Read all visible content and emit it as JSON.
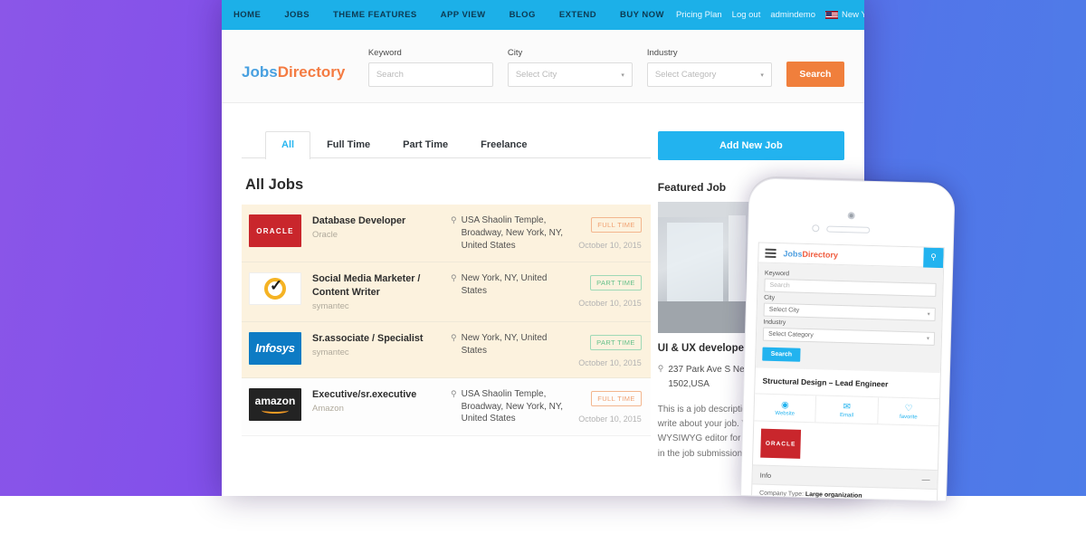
{
  "topnav": {
    "items": [
      "HOME",
      "JOBS",
      "THEME FEATURES",
      "APP VIEW",
      "BLOG",
      "EXTEND",
      "BUY NOW"
    ],
    "pricing_plan": "Pricing Plan",
    "logout": "Log out",
    "username": "admindemo",
    "location": "New York",
    "caret": "⌄"
  },
  "brand": {
    "part1": "Jobs",
    "part2": "Directory"
  },
  "search": {
    "keyword_label": "Keyword",
    "keyword_placeholder": "Search",
    "city_label": "City",
    "city_value": "Select City",
    "industry_label": "Industry",
    "industry_value": "Select Category",
    "button": "Search",
    "caret": "▾"
  },
  "tabs": [
    {
      "label": "All",
      "active": true
    },
    {
      "label": "Full Time",
      "active": false
    },
    {
      "label": "Part Time",
      "active": false
    },
    {
      "label": "Freelance",
      "active": false
    }
  ],
  "section_title": "All Jobs",
  "jobs": [
    {
      "logo": "ORACLE",
      "title": "Database Developer",
      "company": "Oracle",
      "location": "USA Shaolin Temple, Broadway, New York, NY, United States",
      "badge": "FULL TIME",
      "date": "October 10, 2015"
    },
    {
      "logo": "symantec-check",
      "title": "Social Media Marketer / Content Writer",
      "company": "symantec",
      "location": "New York, NY, United States",
      "badge": "PART TIME",
      "date": "October 10, 2015"
    },
    {
      "logo": "Infosys",
      "title": "Sr.associate / Specialist",
      "company": "symantec",
      "location": "New York, NY, United States",
      "badge": "PART TIME",
      "date": "October 10, 2015"
    },
    {
      "logo": "amazon",
      "title": "Executive/sr.executive",
      "company": "Amazon",
      "location": "USA Shaolin Temple, Broadway, New York, NY, United States",
      "badge": "FULL TIME",
      "date": "October 10, 2015"
    }
  ],
  "sidebar": {
    "add_job_button": "Add New Job",
    "featured_heading": "Featured Job",
    "featured_title": "UI & UX developer",
    "featured_location": "237 Park Ave S New York, NY 10003-1502,USA",
    "featured_desc": "This is a job description page where you can write about your job. We have added a WYSIWYG editor for entering this information in the job submission page so you can..."
  },
  "phone": {
    "brand_part1": "Jobs",
    "brand_part2": "Directory",
    "pin_icon": "pin-icon",
    "keyword_label": "Keyword",
    "keyword_placeholder": "Search",
    "city_label": "City",
    "city_value": "Select City",
    "industry_label": "Industry",
    "industry_value": "Select Category",
    "search_button": "Search",
    "job_title": "Structural Design – Lead Engineer",
    "actions": [
      {
        "icon": "globe-icon",
        "glyph": "◉",
        "label": "Website"
      },
      {
        "icon": "envelope-icon",
        "glyph": "✉",
        "label": "Email"
      },
      {
        "icon": "heart-icon",
        "glyph": "♡",
        "label": "favorite"
      }
    ],
    "logo": "ORACLE",
    "info_label": "Info",
    "info_collapse": "—",
    "company_type_label": "Company Type:",
    "company_type_value": "Large organization",
    "caret": "▾"
  },
  "colors": {
    "nav_blue": "#1cb0e8",
    "accent_orange": "#f07f3c",
    "brand_blue": "#48a0e0",
    "highlight_row": "#fcf2de",
    "badge_full": "#f0a070",
    "badge_part": "#63c08a",
    "bg_purple": "#8b56e8",
    "bg_blue": "#4a7ae8"
  }
}
